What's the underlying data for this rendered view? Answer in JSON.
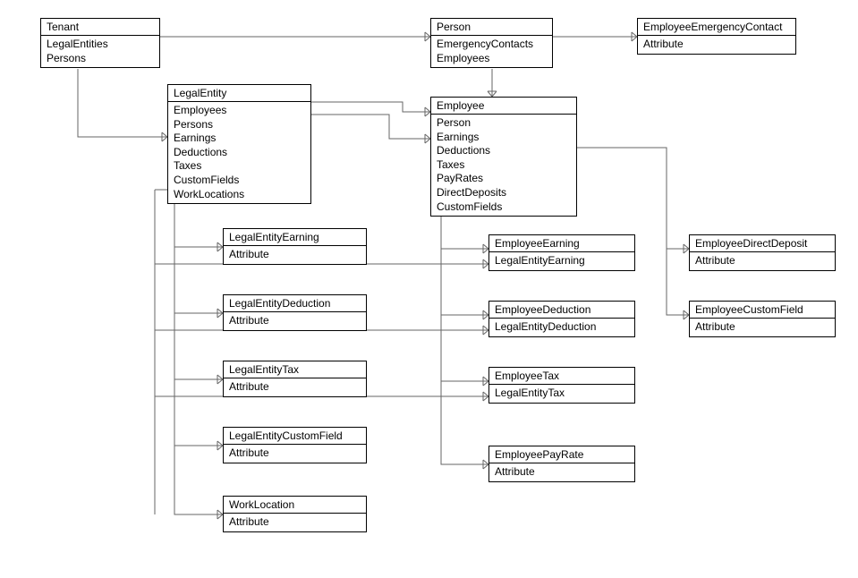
{
  "entities": {
    "tenant": {
      "title": "Tenant",
      "attrs": [
        "LegalEntities",
        "Persons"
      ]
    },
    "legalEntity": {
      "title": "LegalEntity",
      "attrs": [
        "Employees",
        "Persons",
        "Earnings",
        "Deductions",
        "Taxes",
        "CustomFields",
        "WorkLocations"
      ]
    },
    "person": {
      "title": "Person",
      "attrs": [
        "EmergencyContacts",
        "Employees"
      ]
    },
    "employee": {
      "title": "Employee",
      "attrs": [
        "Person",
        "Earnings",
        "Deductions",
        "Taxes",
        "PayRates",
        "DirectDeposits",
        "CustomFields"
      ]
    },
    "emergencyContact": {
      "title": "EmployeeEmergencyContact",
      "attrs": [
        "Attribute"
      ]
    },
    "leEarning": {
      "title": "LegalEntityEarning",
      "attrs": [
        "Attribute"
      ]
    },
    "leDeduction": {
      "title": "LegalEntityDeduction",
      "attrs": [
        "Attribute"
      ]
    },
    "leTax": {
      "title": "LegalEntityTax",
      "attrs": [
        "Attribute"
      ]
    },
    "leCustom": {
      "title": "LegalEntityCustomField",
      "attrs": [
        "Attribute"
      ]
    },
    "workLocation": {
      "title": "WorkLocation",
      "attrs": [
        "Attribute"
      ]
    },
    "empEarning": {
      "title": "EmployeeEarning",
      "attrs": [
        "LegalEntityEarning"
      ]
    },
    "empDeduction": {
      "title": "EmployeeDeduction",
      "attrs": [
        "LegalEntityDeduction"
      ]
    },
    "empTax": {
      "title": "EmployeeTax",
      "attrs": [
        "LegalEntityTax"
      ]
    },
    "empPayRate": {
      "title": "EmployeePayRate",
      "attrs": [
        "Attribute"
      ]
    },
    "empDirectDeposit": {
      "title": "EmployeeDirectDeposit",
      "attrs": [
        "Attribute"
      ]
    },
    "empCustom": {
      "title": "EmployeeCustomField",
      "attrs": [
        "Attribute"
      ]
    }
  }
}
